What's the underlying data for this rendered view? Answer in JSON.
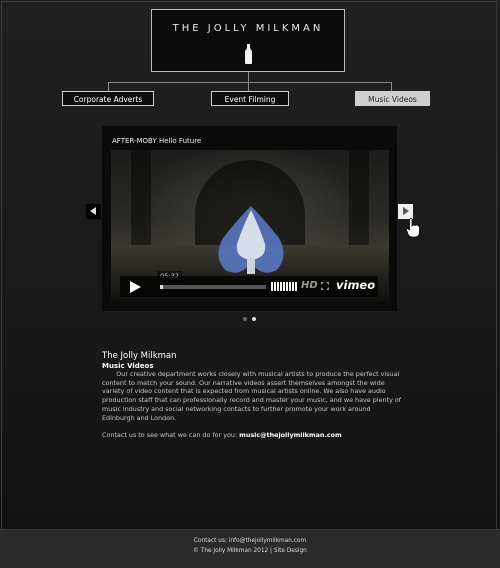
{
  "logo": {
    "title": "THE JOLLY MILKMAN"
  },
  "nav": {
    "items": [
      {
        "label": "Corporate Adverts",
        "active": false
      },
      {
        "label": "Event Filming",
        "active": false
      },
      {
        "label": "Music Videos",
        "active": true
      }
    ]
  },
  "player": {
    "title": "AFTER-MOBY Hello Future",
    "time": "05:32",
    "progress_fraction": 0.03,
    "hd_label": "HD",
    "brand": "vimeo",
    "slide_indicator": {
      "count": 2,
      "active_index": 1
    }
  },
  "about": {
    "heading": "The Jolly Milkman",
    "subheading": "Music Videos",
    "body": "Our creative department works closely with musical artists to produce the perfect visual content to match your sound. Our narrative videos assert themselves amongst the wide variety of video content that is expected from musical artists online. We also have audio production staff that can professionally record and master your music, and we have plenty of music industry and social networking contacts to further promote your work around Edinburgh and London.",
    "contact_prefix": "Contact us to see what we can do for you: ",
    "contact_email": "music@thejollymilkman.com"
  },
  "footer": {
    "contact": "Contact us: info@thejollymilkman.com",
    "copyright": "© The Jolly Milkman 2012 | Site Design"
  },
  "colors": {
    "background": "#191919",
    "nav_active_bg": "#cfcfcf",
    "footer_bg": "#2a2a2a"
  }
}
